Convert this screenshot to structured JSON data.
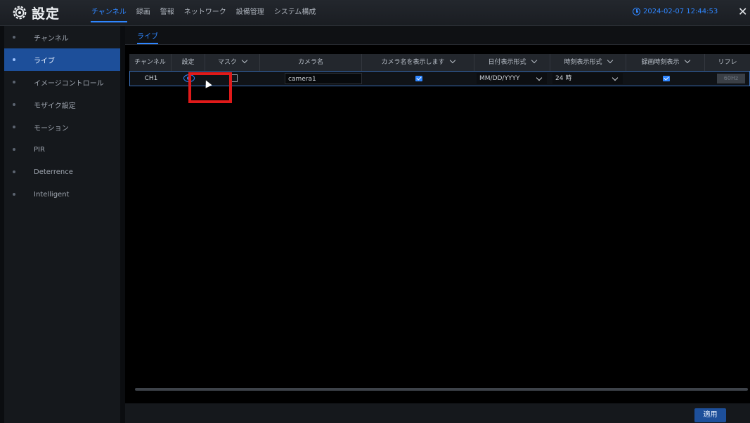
{
  "header": {
    "title": "設定",
    "nav": [
      {
        "label": "チャンネル",
        "active": true
      },
      {
        "label": "録画",
        "active": false
      },
      {
        "label": "警報",
        "active": false
      },
      {
        "label": "ネットワーク",
        "active": false
      },
      {
        "label": "設備管理",
        "active": false
      },
      {
        "label": "システム構成",
        "active": false
      }
    ],
    "datetime": "2024-02-07 12:44:53"
  },
  "sidebar": {
    "items": [
      {
        "label": "チャンネル",
        "active": false
      },
      {
        "label": "ライブ",
        "active": true
      },
      {
        "label": "イメージコントロール",
        "active": false
      },
      {
        "label": "モザイク設定",
        "active": false
      },
      {
        "label": "モーション",
        "active": false
      },
      {
        "label": "PIR",
        "active": false
      },
      {
        "label": "Deterrence",
        "active": false
      },
      {
        "label": "Intelligent",
        "active": false
      }
    ]
  },
  "subtab": {
    "label": "ライブ"
  },
  "table": {
    "headers": [
      "チャンネル",
      "設定",
      "マスク",
      "カメラ名",
      "カメラ名を表示します",
      "日付表示形式",
      "時刻表示形式",
      "録画時刻表示",
      "リフレ"
    ],
    "rows": [
      {
        "channel": "CH1",
        "mask_checked": false,
        "camera_name": "camera1",
        "show_name_checked": true,
        "date_format": "MM/DD/YYYY",
        "time_format": "24 時",
        "record_time_checked": true,
        "refresh": "60Hz"
      }
    ]
  },
  "footer": {
    "apply_label": "適用"
  },
  "colors": {
    "accent": "#2f86ff",
    "active_bg": "#1d4f9a",
    "highlight": "#e01a1a"
  }
}
